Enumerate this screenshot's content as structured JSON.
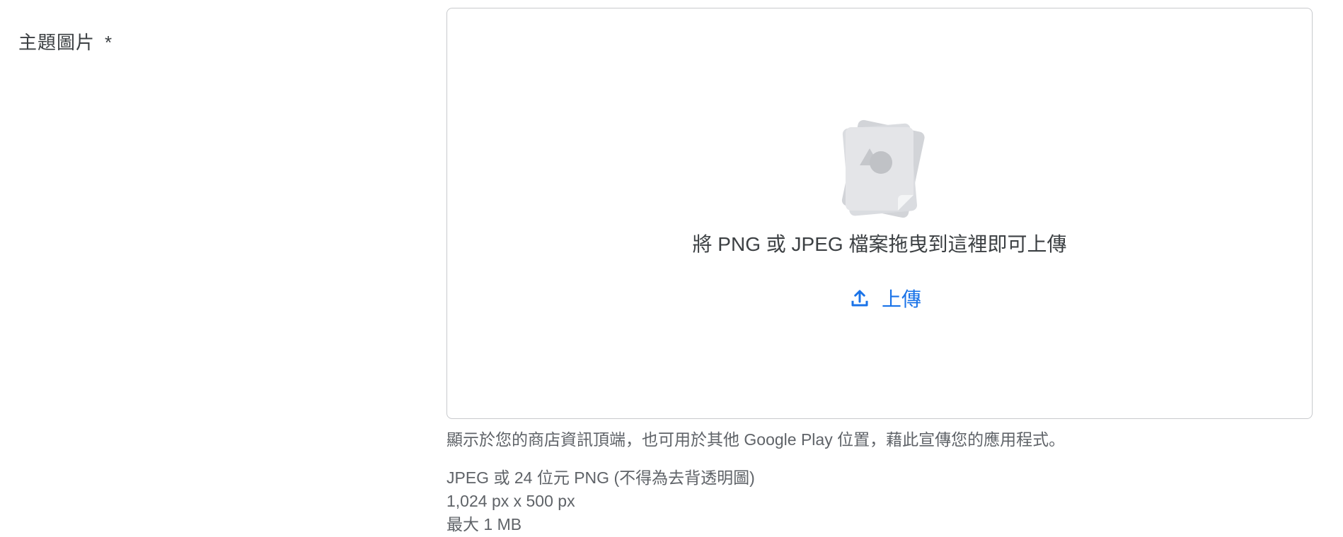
{
  "field": {
    "label": "主題圖片",
    "required_marker": "*"
  },
  "dropzone": {
    "illustration_icon": "image-file-icon",
    "instruction": "將 PNG 或 JPEG 檔案拖曳到這裡即可上傳",
    "upload_label": "上傳",
    "upload_icon": "upload-icon",
    "accent_color": "#1a73e8"
  },
  "help": {
    "description": "顯示於您的商店資訊頂端，也可用於其他 Google Play 位置，藉此宣傳您的應用程式。"
  },
  "requirements": [
    "JPEG 或 24 位元 PNG (不得為去背透明圖)",
    "1,024 px x 500 px",
    "最大 1 MB"
  ]
}
